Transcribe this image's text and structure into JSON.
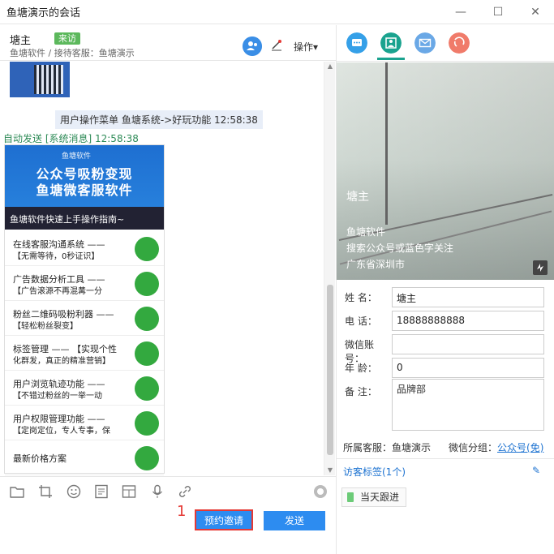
{
  "window": {
    "title": "鱼塘演示的会话",
    "minimize": "—",
    "maximize": "☐",
    "close": "✕"
  },
  "header": {
    "user_name": "塘主",
    "visitor_badge": "来访",
    "sub_info": "鱼塘软件 / 接待客服：鱼塘演示",
    "operations_label": "操作▾"
  },
  "chat": {
    "system_message": "用户操作菜单  鱼塘系统->好玩功能  12:58:38",
    "auto_send": "自动发送  [系统消息]  12:58:38",
    "card": {
      "logo_text": "鱼塘软件",
      "banner_line1": "公众号吸粉变现",
      "banner_line2": "鱼塘微客服软件",
      "banner_caption": "鱼塘软件快速上手操作指南~",
      "items": [
        {
          "title": "在线客服沟通系统 ——",
          "desc": "【无需等待，0秒证识】"
        },
        {
          "title": "广告数据分析工具 ——",
          "desc": "【广告滚源不再混冓一分"
        },
        {
          "title": "粉丝二维码吸粉利器 ——",
          "desc": "【轻松粉丝裂变】"
        },
        {
          "title": "标签管理 —— 【实现个性",
          "desc": "化群发，真正的精准营销】"
        },
        {
          "title": "用户浏览轨迹功能 ——",
          "desc": "【不错过粉丝的一举一动"
        },
        {
          "title": "用户权限管理功能 ——",
          "desc": "【定岗定位，专人专事，保"
        },
        {
          "title": "最新价格方案",
          "desc": ""
        }
      ]
    }
  },
  "toolbar": {
    "icons": [
      "folder-icon",
      "crop-icon",
      "emoji-icon",
      "article-icon",
      "layout-icon",
      "mic-icon",
      "link-icon",
      "headset-icon"
    ]
  },
  "actions": {
    "annotation_number": "1",
    "book_invite": "预约邀请",
    "send": "发送"
  },
  "profile": {
    "name": "塘主",
    "company": "鱼塘软件",
    "source": "搜索公众号或蓝色字关注",
    "location": "广东省深圳市",
    "fields": {
      "name_label": "姓    名：",
      "name_value": "塘主",
      "phone_label": "电    话：",
      "phone_value": "18888888888",
      "wechat_label": "微信账号：",
      "wechat_value": "",
      "age_label": "年    龄：",
      "age_value": "0",
      "remark_label": "备    注：",
      "remark_value": "品牌部"
    },
    "owner": "所属客服：鱼塘演示",
    "wechat_group_label": "微信分组：",
    "wechat_group_value": "公众号(免)",
    "tags_title": "访客标签(1个)",
    "tag": "当天跟进"
  }
}
